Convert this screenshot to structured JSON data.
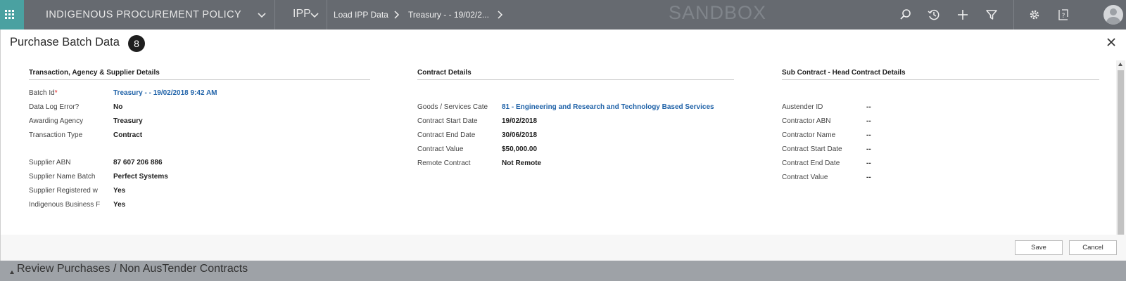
{
  "topbar": {
    "app_title": "INDIGENOUS PROCUREMENT POLICY",
    "area": "IPP",
    "breadcrumbs": [
      "Load IPP Data",
      "Treasury - - 19/02/2..."
    ],
    "environment": "SANDBOX",
    "icons": [
      "apps-grid-icon",
      "chevron-down-icon",
      "search-icon",
      "history-icon",
      "plus-icon",
      "filter-icon",
      "gear-icon",
      "help-icon",
      "user-avatar"
    ]
  },
  "dialog": {
    "title": "Purchase Batch Data",
    "badge": "8",
    "sections": [
      {
        "title": "Transaction, Agency & Supplier Details",
        "fields": [
          {
            "label": "Batch Id",
            "required": "*",
            "value": "Treasury - - 19/02/2018 9:42 AM",
            "link": true
          },
          {
            "label": "Data Log Error?",
            "value": "No"
          },
          {
            "label": "Awarding Agency",
            "value": "Treasury"
          },
          {
            "label": "Transaction Type",
            "value": "Contract"
          },
          {
            "label": "Supplier ABN",
            "value": "87 607 206 886"
          },
          {
            "label": "Supplier Name Batch",
            "value": "Perfect Systems"
          },
          {
            "label": "Supplier Registered w",
            "value": "Yes"
          },
          {
            "label": "Indigenous Business F",
            "value": "Yes"
          }
        ]
      },
      {
        "title": "Contract Details",
        "fields": [
          {
            "label": "Goods / Services Cate",
            "value": "81 - Engineering and Research and Technology Based Services",
            "link": true
          },
          {
            "label": "Contract Start Date",
            "value": "19/02/2018"
          },
          {
            "label": "Contract End Date",
            "value": "30/06/2018"
          },
          {
            "label": "Contract Value",
            "value": "$50,000.00"
          },
          {
            "label": "Remote Contract",
            "value": "Not Remote"
          }
        ]
      },
      {
        "title": "Sub Contract - Head Contract Details",
        "fields": [
          {
            "label": "Austender ID",
            "value": "--"
          },
          {
            "label": "Contractor ABN",
            "value": "--"
          },
          {
            "label": "Contractor Name",
            "value": "--"
          },
          {
            "label": "Contract Start Date",
            "value": "--"
          },
          {
            "label": "Contract End Date",
            "value": "--"
          },
          {
            "label": "Contract Value",
            "value": "--"
          }
        ]
      }
    ],
    "buttons": {
      "save": "Save",
      "cancel": "Cancel"
    }
  },
  "background": {
    "section_label": "Review Purchases / Non AusTender Contracts"
  },
  "colors": {
    "topbar": "#666a70",
    "apps_tile": "#4aa1a1",
    "link": "#1f62a8",
    "required": "#dd1111"
  }
}
